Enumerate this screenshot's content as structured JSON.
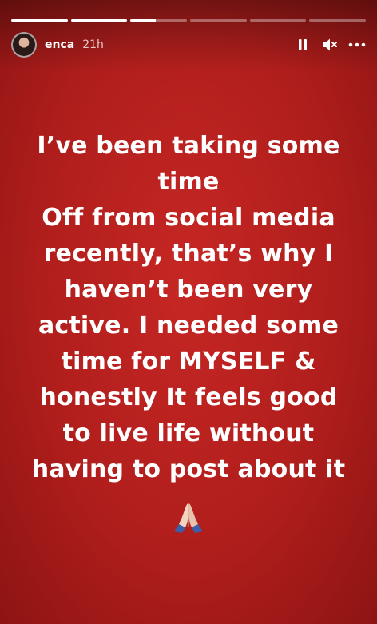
{
  "story": {
    "username": "enca",
    "time_ago": "21h",
    "progress": [
      1,
      1,
      0.45,
      0,
      0,
      0
    ],
    "text_lines": [
      "I’ve been taking some",
      "time",
      "Off from social media",
      "recently, that’s why I",
      "haven’t been very",
      "active. I needed some",
      "time for MYSELF &",
      "honestly It feels good",
      "to live life without",
      "having to post about it"
    ],
    "emoji": "folded-hands-icon",
    "background_color": "#b71f1d"
  },
  "controls": {
    "pause_icon": "pause-icon",
    "mute_icon": "muted-speaker-icon",
    "more_icon": "more-options-icon"
  }
}
